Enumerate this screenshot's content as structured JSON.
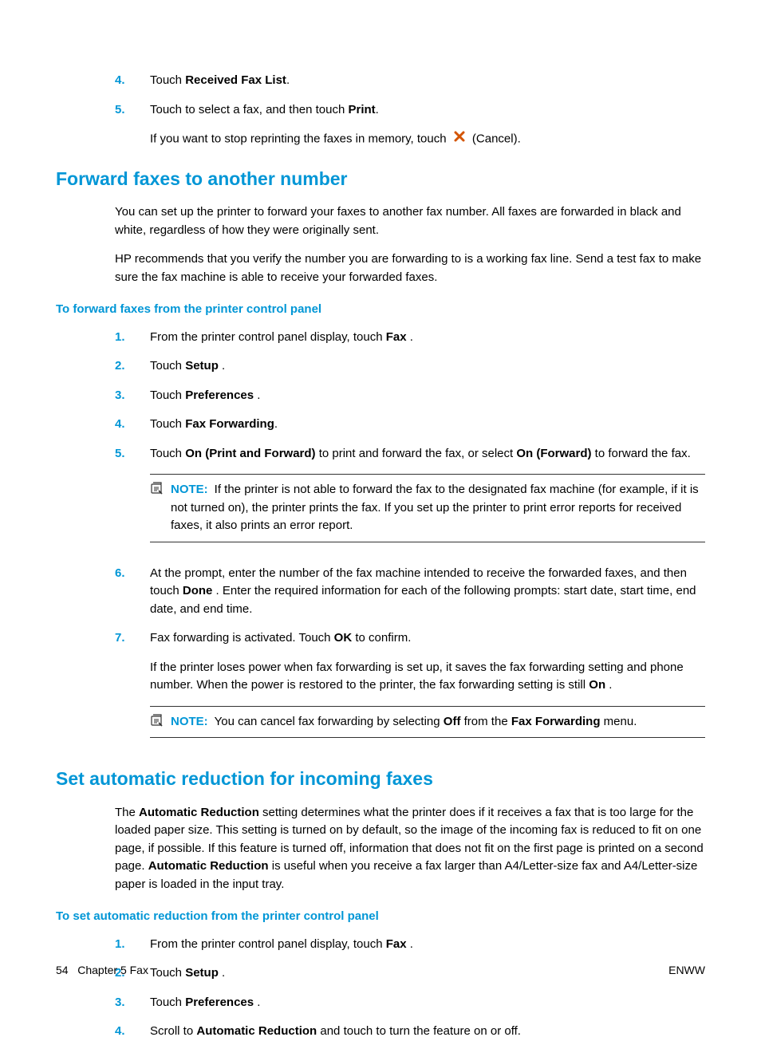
{
  "steps_top": {
    "s4_num": "4.",
    "s4_a": "Touch ",
    "s4_b": "Received Fax List",
    "s4_c": ".",
    "s5_num": "5.",
    "s5_a": "Touch to select a fax, and then touch ",
    "s5_b": "Print",
    "s5_c": ".",
    "s5_p2a": "If you want to stop reprinting the faxes in memory, touch ",
    "s5_p2b": " (Cancel)."
  },
  "forward": {
    "heading": "Forward faxes to another number",
    "p1": "You can set up the printer to forward your faxes to another fax number. All faxes are forwarded in black and white, regardless of how they were originally sent.",
    "p2": "HP recommends that you verify the number you are forwarding to is a working fax line. Send a test fax to make sure the fax machine is able to receive your forwarded faxes.",
    "subheading": "To forward faxes from the printer control panel",
    "s1_num": "1.",
    "s1_a": "From the printer control panel display, touch ",
    "s1_b": "Fax",
    "s1_c": " .",
    "s2_num": "2.",
    "s2_a": "Touch ",
    "s2_b": "Setup",
    "s2_c": " .",
    "s3_num": "3.",
    "s3_a": "Touch ",
    "s3_b": "Preferences",
    "s3_c": " .",
    "s4_num": "4.",
    "s4_a": "Touch ",
    "s4_b": "Fax Forwarding",
    "s4_c": ".",
    "s5_num": "5.",
    "s5_a": "Touch ",
    "s5_b": "On (Print and Forward)",
    "s5_c": " to print and forward the fax, or select ",
    "s5_d": "On (Forward)",
    "s5_e": " to forward the fax.",
    "note1_label": "NOTE:",
    "note1_text": "If the printer is not able to forward the fax to the designated fax machine (for example, if it is not turned on), the printer prints the fax. If you set up the printer to print error reports for received faxes, it also prints an error report.",
    "s6_num": "6.",
    "s6_a": "At the prompt, enter the number of the fax machine intended to receive the forwarded faxes, and then touch ",
    "s6_b": "Done",
    "s6_c": " . Enter the required information for each of the following prompts: start date, start time, end date, and end time.",
    "s7_num": "7.",
    "s7_a": "Fax forwarding is activated. Touch ",
    "s7_b": "OK",
    "s7_c": " to confirm.",
    "s7_p2a": "If the printer loses power when fax forwarding is set up, it saves the fax forwarding setting and phone number. When the power is restored to the printer, the fax forwarding setting is still ",
    "s7_p2b": "On",
    "s7_p2c": " .",
    "note2_label": "NOTE:",
    "note2_a": "You can cancel fax forwarding by selecting ",
    "note2_b": "Off",
    "note2_c": " from the ",
    "note2_d": "Fax Forwarding",
    "note2_e": " menu."
  },
  "reduction": {
    "heading": "Set automatic reduction for incoming faxes",
    "p1_a": "The ",
    "p1_b": "Automatic Reduction",
    "p1_c": " setting determines what the printer does if it receives a fax that is too large for the loaded paper size. This setting is turned on by default, so the image of the incoming fax is reduced to fit on one page, if possible. If this feature is turned off, information that does not fit on the first page is printed on a second page. ",
    "p1_d": "Automatic Reduction",
    "p1_e": " is useful when you receive a fax larger than A4/Letter-size fax and A4/Letter-size paper is loaded in the input tray.",
    "subheading": "To set automatic reduction from the printer control panel",
    "s1_num": "1.",
    "s1_a": "From the printer control panel display, touch ",
    "s1_b": "Fax",
    "s1_c": " .",
    "s2_num": "2.",
    "s2_a": "Touch ",
    "s2_b": "Setup",
    "s2_c": " .",
    "s3_num": "3.",
    "s3_a": "Touch ",
    "s3_b": "Preferences",
    "s3_c": " .",
    "s4_num": "4.",
    "s4_a": "Scroll to ",
    "s4_b": "Automatic Reduction",
    "s4_c": " and touch to turn the feature on or off."
  },
  "footer": {
    "page": "54",
    "chapter": "Chapter 5   Fax",
    "right": "ENWW"
  }
}
